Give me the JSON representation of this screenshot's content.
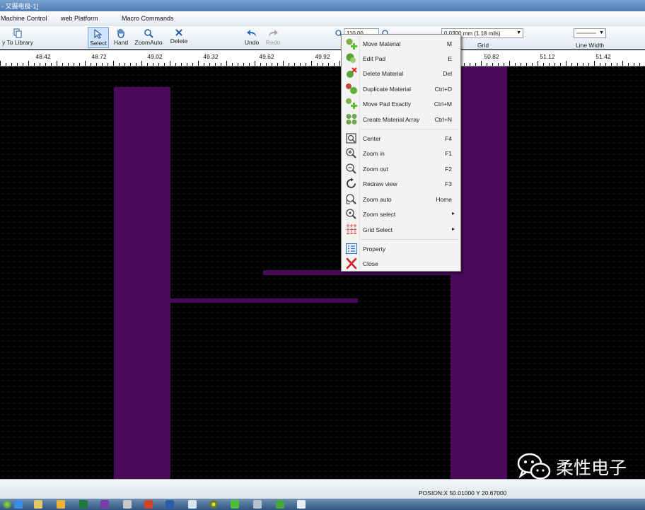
{
  "window": {
    "title": "- 又摄电极-1]"
  },
  "menubar": {
    "items": [
      "Machine Control",
      "web Platform",
      "Macro Commands"
    ]
  },
  "toolbar": {
    "buttons": [
      {
        "label": "y To Library",
        "icon": "copy-icon"
      },
      {
        "label": "Select",
        "icon": "select-arrow-icon",
        "active": true
      },
      {
        "label": "Hand",
        "icon": "hand-icon"
      },
      {
        "label": "ZoomAuto",
        "icon": "zoom-auto-icon"
      },
      {
        "label": "Delete",
        "icon": "delete-x-icon"
      },
      {
        "label": "Undo",
        "icon": "undo-icon"
      },
      {
        "label": "Redo",
        "icon": "redo-icon",
        "disabled": true
      }
    ],
    "zoom_value": "110.00",
    "grid_value": "0.0300 mm (1.18 mils)",
    "grid_caption": "Grid",
    "line_width_caption": "Line Width"
  },
  "ruler": {
    "labels": [
      "48.42",
      "48.72",
      "49.02",
      "49.32",
      "49.62",
      "49.92",
      "50.82",
      "51.12",
      "51.42"
    ]
  },
  "context_menu": {
    "items": [
      {
        "label": "Move Material",
        "shortcut": "M",
        "icon": "move-material-icon"
      },
      {
        "label": "Edit Pad",
        "shortcut": "E",
        "icon": "edit-pad-icon"
      },
      {
        "label": "Delete Material",
        "shortcut": "Del",
        "icon": "delete-material-icon"
      },
      {
        "label": "Duplicate Material",
        "shortcut": "Ctrl+D",
        "icon": "duplicate-material-icon"
      },
      {
        "label": "Move Pad Exactly",
        "shortcut": "Ctrl+M",
        "icon": "move-pad-exactly-icon"
      },
      {
        "label": "Create Material Array",
        "shortcut": "Ctrl+N",
        "icon": "material-array-icon"
      },
      {
        "label": "Center",
        "shortcut": "F4",
        "icon": "center-icon"
      },
      {
        "label": "Zoom in",
        "shortcut": "F1",
        "icon": "zoom-in-icon"
      },
      {
        "label": "Zoom out",
        "shortcut": "F2",
        "icon": "zoom-out-icon"
      },
      {
        "label": "Redraw view",
        "shortcut": "F3",
        "icon": "redraw-icon"
      },
      {
        "label": "Zoom auto",
        "shortcut": "Home",
        "icon": "zoom-auto-icon"
      },
      {
        "label": "Zoom select",
        "shortcut": "",
        "icon": "zoom-select-icon",
        "submenu": true
      },
      {
        "label": "Grid Select",
        "shortcut": "",
        "icon": "grid-select-icon",
        "submenu": true
      },
      {
        "label": "Property",
        "shortcut": "",
        "icon": "property-icon"
      },
      {
        "label": "Close",
        "shortcut": "",
        "icon": "close-icon"
      }
    ]
  },
  "status": {
    "position": "POSION:X 50.01000  Y 20.67000"
  },
  "watermark": {
    "text": "柔性电子"
  },
  "colors": {
    "pad": "#4a0a5a",
    "canvas": "#000000",
    "menu_bg": "#f3f3f3"
  }
}
